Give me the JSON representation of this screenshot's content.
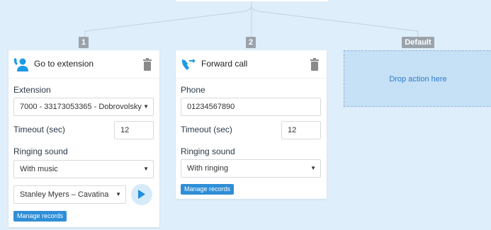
{
  "branches": [
    {
      "number": "1"
    },
    {
      "number": "2"
    },
    {
      "number": "Default"
    }
  ],
  "card1": {
    "title": "Go to extension",
    "icon": "person-call-icon",
    "extension_label": "Extension",
    "extension_value": "7000 - 33173053365 - Dobrovolsky",
    "timeout_label": "Timeout (sec)",
    "timeout_value": "12",
    "ringing_label": "Ringing sound",
    "ringing_value": "With music",
    "track_value": "Stanley Myers – Cavatina",
    "manage_label": "Manage records"
  },
  "card2": {
    "title": "Forward call",
    "icon": "call-forward-icon",
    "phone_label": "Phone",
    "phone_value": "01234567890",
    "timeout_label": "Timeout (sec)",
    "timeout_value": "12",
    "ringing_label": "Ringing sound",
    "ringing_value": "With ringing",
    "manage_label": "Manage records"
  },
  "drop": {
    "label": "Drop action here"
  },
  "colors": {
    "background": "#deeefa",
    "accent": "#2f8ed6",
    "badge": "#9aa3ab",
    "drop_zone": "#c6e0f6"
  }
}
